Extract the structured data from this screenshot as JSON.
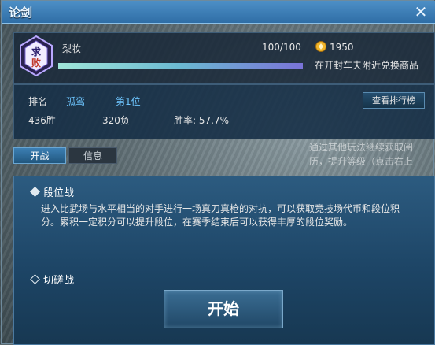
{
  "window": {
    "title": "论剑",
    "close_label": "✕"
  },
  "world_hint": {
    "line1": "通过其他玩法继续获取阅",
    "line2": "历，提升等级（点击右上"
  },
  "player": {
    "name": "梨妆",
    "emblem_text": "求败",
    "hp_text": "100/100",
    "hp_fraction": 1.0,
    "coin_value": "1950",
    "exchange_hint": "在开封车夫附近兑换商品"
  },
  "rank": {
    "label": "排名",
    "tier": "孤鸾",
    "position": "第1位",
    "leaderboard_button": "查看排行榜",
    "wins": "436胜",
    "losses": "320负",
    "winrate": "胜率: 57.7%"
  },
  "tabs": [
    {
      "label": "开战",
      "active": true
    },
    {
      "label": "信息",
      "active": false
    }
  ],
  "modes": {
    "ranked": {
      "label": "段位战",
      "selected": true,
      "description": "进入比武场与水平相当的对手进行一场真刀真枪的对抗，可以获取竞技场代币和段位积分。累积一定积分可以提升段位，在赛季结束后可以获得丰厚的段位奖励。"
    },
    "spar": {
      "label": "切磋战",
      "selected": false
    }
  },
  "start_button": "开始",
  "colors": {
    "accent": "#6ec6ff",
    "title_bar": "#3a7fb8",
    "panel": "#1d4566"
  }
}
